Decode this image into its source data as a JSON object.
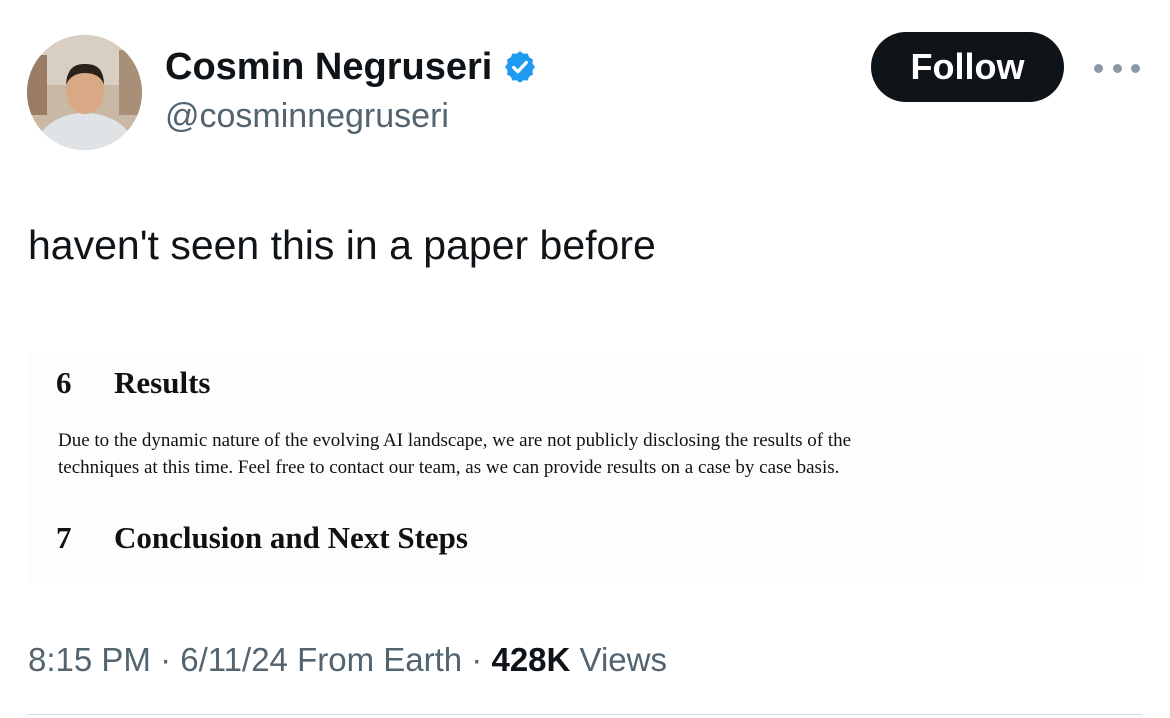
{
  "author": {
    "display_name": "Cosmin Negruseri",
    "handle": "@cosminnegruseri",
    "verified_color": "#1d9bf0"
  },
  "actions": {
    "follow_label": "Follow",
    "more_icon": "more-horizontal-icon"
  },
  "tweet": {
    "text": "haven't seen this in a paper before"
  },
  "paper_image": {
    "section6_number": "6",
    "section6_title": "Results",
    "paragraph_line1": "Due to the dynamic nature of the evolving AI landscape, we are not publicly disclosing the results of the",
    "paragraph_line2": "techniques at this time. Feel free to contact our team, as we can provide results on a case by case basis.",
    "section7_number": "7",
    "section7_title": "Conclusion and Next Steps"
  },
  "meta": {
    "time": "8:15 PM",
    "date": "6/11/24",
    "location": "From Earth",
    "views_count": "428K",
    "views_label": "Views"
  }
}
